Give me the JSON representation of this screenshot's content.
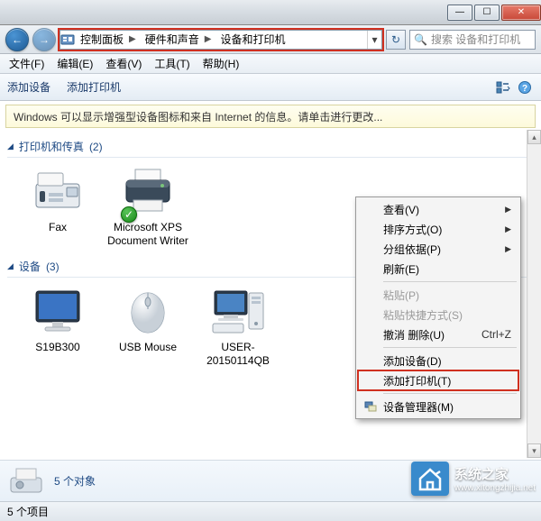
{
  "titlebar": {
    "min": "—",
    "max": "☐",
    "close": "✕"
  },
  "nav": {
    "back_glyph": "←",
    "fwd_glyph": "→",
    "crumb1": "控制面板",
    "crumb2": "硬件和声音",
    "crumb3": "设备和打印机",
    "sep": "▶",
    "dropdown": "▾",
    "refresh": "↻"
  },
  "search": {
    "placeholder": "搜索 设备和打印机",
    "icon": "🔍"
  },
  "menu": {
    "file": "文件(F)",
    "edit": "编辑(E)",
    "view": "查看(V)",
    "tools": "工具(T)",
    "help": "帮助(H)"
  },
  "cmd": {
    "add_device": "添加设备",
    "add_printer": "添加打印机"
  },
  "infobar": "Windows 可以显示增强型设备图标和来自 Internet 的信息。请单击进行更改...",
  "groups": {
    "printers": {
      "label": "打印机和传真",
      "count": "(2)"
    },
    "devices": {
      "label": "设备",
      "count": "(3)"
    }
  },
  "items": {
    "fax": "Fax",
    "xps": "Microsoft XPS Document Writer",
    "monitor": "S19B300",
    "mouse": "USB Mouse",
    "pc": "USER-20150114QB"
  },
  "ctx": {
    "view": "查看(V)",
    "sort": "排序方式(O)",
    "group": "分组依据(P)",
    "refresh": "刷新(E)",
    "paste": "粘贴(P)",
    "paste_shortcut": "粘贴快捷方式(S)",
    "undo_delete": "撤消 删除(U)",
    "undo_delete_key": "Ctrl+Z",
    "add_device": "添加设备(D)",
    "add_printer": "添加打印机(T)",
    "dev_mgr": "设备管理器(M)",
    "arrow": "▶"
  },
  "details": {
    "title": "5 个对象"
  },
  "status": {
    "text": "5 个项目"
  },
  "watermark": {
    "title": "系统之家",
    "sub": "www.xitongzhijia.net"
  },
  "check": "✓"
}
